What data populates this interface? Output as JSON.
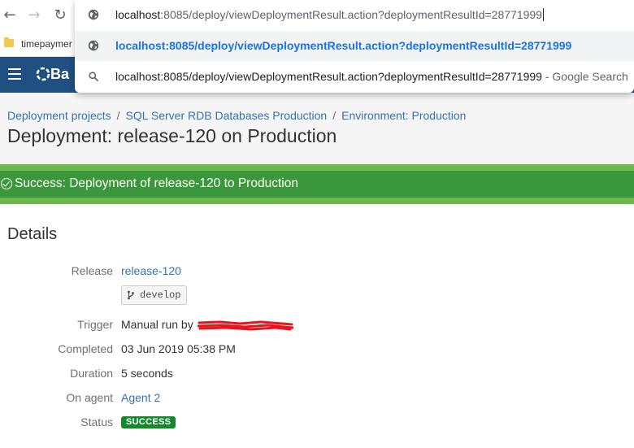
{
  "browser": {
    "back_icon": "arrow-left-icon",
    "forward_icon": "arrow-right-icon",
    "reload_icon": "reload-icon",
    "bookmark": {
      "icon": "folder-icon",
      "label": "timepaymer"
    },
    "omnibox": {
      "input": {
        "host": "localhost",
        "path": ":8085/deploy/viewDeploymentResult.action?deploymentResultId=28771999"
      },
      "suggestions": [
        {
          "icon": "globe-icon",
          "text": "localhost:8085/deploy/viewDeploymentResult.action?deploymentResultId=28771999"
        },
        {
          "icon": "search-icon",
          "text": "localhost:8085/deploy/viewDeploymentResult.action?deploymentResultId=28771999",
          "suffix": " - Google Search"
        }
      ]
    }
  },
  "app": {
    "menu_icon": "hamburger-menu-icon",
    "logo_text": "Ba"
  },
  "breadcrumb": [
    "Deployment projects",
    "SQL Server RDB Databases Production",
    "Environment: Production"
  ],
  "page_title": "Deployment: release-120 on Production",
  "banner": {
    "icon": "check-circle-icon",
    "text": "Success: Deployment of release-120 to Production",
    "color": "#3b973b"
  },
  "details": {
    "title": "Details",
    "release_label": "Release",
    "release_value": "release-120",
    "branch": "develop",
    "trigger_label": "Trigger",
    "trigger_value": "Manual run by",
    "completed_label": "Completed",
    "completed_value": "03 Jun 2019 05:38 PM",
    "duration_label": "Duration",
    "duration_value": "5 seconds",
    "agent_label": "On agent",
    "agent_value": "Agent 2",
    "status_label": "Status",
    "status_value": "SUCCESS",
    "status_color": "#14892c"
  }
}
